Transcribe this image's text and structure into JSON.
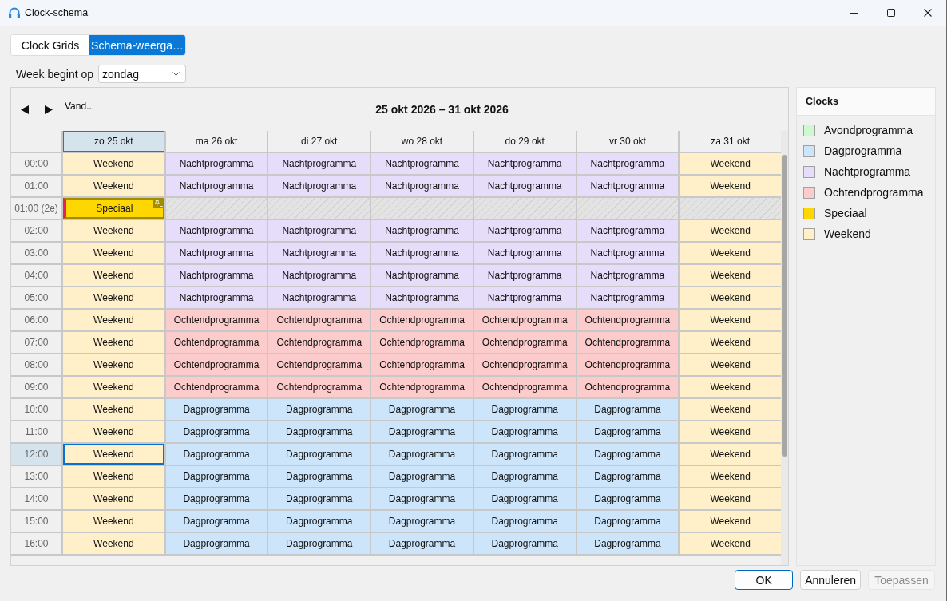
{
  "window": {
    "title": "Clock-schema"
  },
  "tabs": [
    {
      "label": "Clock Grids",
      "selected": false
    },
    {
      "label": "Schema-weerga…",
      "selected": true
    }
  ],
  "week_start": {
    "label": "Week begint op",
    "value": "zondag"
  },
  "calendar": {
    "today_button": "Vand...",
    "range_title": "25 okt 2026 – 31 okt 2026",
    "columns": [
      {
        "label": "zo 25 okt",
        "selected": true
      },
      {
        "label": "ma 26 okt",
        "selected": false
      },
      {
        "label": "di 27 okt",
        "selected": false
      },
      {
        "label": "wo 28 okt",
        "selected": false
      },
      {
        "label": "do 29 okt",
        "selected": false
      },
      {
        "label": "vr 30 okt",
        "selected": false
      },
      {
        "label": "za 31 okt",
        "selected": false
      }
    ],
    "rows": [
      {
        "time": "00:00",
        "selected": false,
        "cells": [
          {
            "kind": "clock",
            "text": "Weekend",
            "color": "#fff0c9"
          },
          {
            "kind": "clock",
            "text": "Nachtprogramma",
            "color": "#e6ddfb"
          },
          {
            "kind": "clock",
            "text": "Nachtprogramma",
            "color": "#e6ddfb"
          },
          {
            "kind": "clock",
            "text": "Nachtprogramma",
            "color": "#e6ddfb"
          },
          {
            "kind": "clock",
            "text": "Nachtprogramma",
            "color": "#e6ddfb"
          },
          {
            "kind": "clock",
            "text": "Nachtprogramma",
            "color": "#e6ddfb"
          },
          {
            "kind": "clock",
            "text": "Weekend",
            "color": "#fff0c9"
          }
        ]
      },
      {
        "time": "01:00",
        "selected": false,
        "cells": [
          {
            "kind": "clock",
            "text": "Weekend",
            "color": "#fff0c9"
          },
          {
            "kind": "clock",
            "text": "Nachtprogramma",
            "color": "#e6ddfb"
          },
          {
            "kind": "clock",
            "text": "Nachtprogramma",
            "color": "#e6ddfb"
          },
          {
            "kind": "clock",
            "text": "Nachtprogramma",
            "color": "#e6ddfb"
          },
          {
            "kind": "clock",
            "text": "Nachtprogramma",
            "color": "#e6ddfb"
          },
          {
            "kind": "clock",
            "text": "Nachtprogramma",
            "color": "#e6ddfb"
          },
          {
            "kind": "clock",
            "text": "Weekend",
            "color": "#fff0c9"
          }
        ]
      },
      {
        "time": "01:00 (2e)",
        "selected": false,
        "cells": [
          {
            "kind": "event",
            "text": "Speciaal",
            "color": "#ffd700"
          },
          {
            "kind": "unavailable"
          },
          {
            "kind": "unavailable"
          },
          {
            "kind": "unavailable"
          },
          {
            "kind": "unavailable"
          },
          {
            "kind": "unavailable"
          },
          {
            "kind": "unavailable"
          }
        ]
      },
      {
        "time": "02:00",
        "selected": false,
        "cells": [
          {
            "kind": "clock",
            "text": "Weekend",
            "color": "#fff0c9"
          },
          {
            "kind": "clock",
            "text": "Nachtprogramma",
            "color": "#e6ddfb"
          },
          {
            "kind": "clock",
            "text": "Nachtprogramma",
            "color": "#e6ddfb"
          },
          {
            "kind": "clock",
            "text": "Nachtprogramma",
            "color": "#e6ddfb"
          },
          {
            "kind": "clock",
            "text": "Nachtprogramma",
            "color": "#e6ddfb"
          },
          {
            "kind": "clock",
            "text": "Nachtprogramma",
            "color": "#e6ddfb"
          },
          {
            "kind": "clock",
            "text": "Weekend",
            "color": "#fff0c9"
          }
        ]
      },
      {
        "time": "03:00",
        "selected": false,
        "cells": [
          {
            "kind": "clock",
            "text": "Weekend",
            "color": "#fff0c9"
          },
          {
            "kind": "clock",
            "text": "Nachtprogramma",
            "color": "#e6ddfb"
          },
          {
            "kind": "clock",
            "text": "Nachtprogramma",
            "color": "#e6ddfb"
          },
          {
            "kind": "clock",
            "text": "Nachtprogramma",
            "color": "#e6ddfb"
          },
          {
            "kind": "clock",
            "text": "Nachtprogramma",
            "color": "#e6ddfb"
          },
          {
            "kind": "clock",
            "text": "Nachtprogramma",
            "color": "#e6ddfb"
          },
          {
            "kind": "clock",
            "text": "Weekend",
            "color": "#fff0c9"
          }
        ]
      },
      {
        "time": "04:00",
        "selected": false,
        "cells": [
          {
            "kind": "clock",
            "text": "Weekend",
            "color": "#fff0c9"
          },
          {
            "kind": "clock",
            "text": "Nachtprogramma",
            "color": "#e6ddfb"
          },
          {
            "kind": "clock",
            "text": "Nachtprogramma",
            "color": "#e6ddfb"
          },
          {
            "kind": "clock",
            "text": "Nachtprogramma",
            "color": "#e6ddfb"
          },
          {
            "kind": "clock",
            "text": "Nachtprogramma",
            "color": "#e6ddfb"
          },
          {
            "kind": "clock",
            "text": "Nachtprogramma",
            "color": "#e6ddfb"
          },
          {
            "kind": "clock",
            "text": "Weekend",
            "color": "#fff0c9"
          }
        ]
      },
      {
        "time": "05:00",
        "selected": false,
        "cells": [
          {
            "kind": "clock",
            "text": "Weekend",
            "color": "#fff0c9"
          },
          {
            "kind": "clock",
            "text": "Nachtprogramma",
            "color": "#e6ddfb"
          },
          {
            "kind": "clock",
            "text": "Nachtprogramma",
            "color": "#e6ddfb"
          },
          {
            "kind": "clock",
            "text": "Nachtprogramma",
            "color": "#e6ddfb"
          },
          {
            "kind": "clock",
            "text": "Nachtprogramma",
            "color": "#e6ddfb"
          },
          {
            "kind": "clock",
            "text": "Nachtprogramma",
            "color": "#e6ddfb"
          },
          {
            "kind": "clock",
            "text": "Weekend",
            "color": "#fff0c9"
          }
        ]
      },
      {
        "time": "06:00",
        "selected": false,
        "cells": [
          {
            "kind": "clock",
            "text": "Weekend",
            "color": "#fff0c9"
          },
          {
            "kind": "clock",
            "text": "Ochtendprogramma",
            "color": "#fccbcb"
          },
          {
            "kind": "clock",
            "text": "Ochtendprogramma",
            "color": "#fccbcb"
          },
          {
            "kind": "clock",
            "text": "Ochtendprogramma",
            "color": "#fccbcb"
          },
          {
            "kind": "clock",
            "text": "Ochtendprogramma",
            "color": "#fccbcb"
          },
          {
            "kind": "clock",
            "text": "Ochtendprogramma",
            "color": "#fccbcb"
          },
          {
            "kind": "clock",
            "text": "Weekend",
            "color": "#fff0c9"
          }
        ]
      },
      {
        "time": "07:00",
        "selected": false,
        "cells": [
          {
            "kind": "clock",
            "text": "Weekend",
            "color": "#fff0c9"
          },
          {
            "kind": "clock",
            "text": "Ochtendprogramma",
            "color": "#fccbcb"
          },
          {
            "kind": "clock",
            "text": "Ochtendprogramma",
            "color": "#fccbcb"
          },
          {
            "kind": "clock",
            "text": "Ochtendprogramma",
            "color": "#fccbcb"
          },
          {
            "kind": "clock",
            "text": "Ochtendprogramma",
            "color": "#fccbcb"
          },
          {
            "kind": "clock",
            "text": "Ochtendprogramma",
            "color": "#fccbcb"
          },
          {
            "kind": "clock",
            "text": "Weekend",
            "color": "#fff0c9"
          }
        ]
      },
      {
        "time": "08:00",
        "selected": false,
        "cells": [
          {
            "kind": "clock",
            "text": "Weekend",
            "color": "#fff0c9"
          },
          {
            "kind": "clock",
            "text": "Ochtendprogramma",
            "color": "#fccbcb"
          },
          {
            "kind": "clock",
            "text": "Ochtendprogramma",
            "color": "#fccbcb"
          },
          {
            "kind": "clock",
            "text": "Ochtendprogramma",
            "color": "#fccbcb"
          },
          {
            "kind": "clock",
            "text": "Ochtendprogramma",
            "color": "#fccbcb"
          },
          {
            "kind": "clock",
            "text": "Ochtendprogramma",
            "color": "#fccbcb"
          },
          {
            "kind": "clock",
            "text": "Weekend",
            "color": "#fff0c9"
          }
        ]
      },
      {
        "time": "09:00",
        "selected": false,
        "cells": [
          {
            "kind": "clock",
            "text": "Weekend",
            "color": "#fff0c9"
          },
          {
            "kind": "clock",
            "text": "Ochtendprogramma",
            "color": "#fccbcb"
          },
          {
            "kind": "clock",
            "text": "Ochtendprogramma",
            "color": "#fccbcb"
          },
          {
            "kind": "clock",
            "text": "Ochtendprogramma",
            "color": "#fccbcb"
          },
          {
            "kind": "clock",
            "text": "Ochtendprogramma",
            "color": "#fccbcb"
          },
          {
            "kind": "clock",
            "text": "Ochtendprogramma",
            "color": "#fccbcb"
          },
          {
            "kind": "clock",
            "text": "Weekend",
            "color": "#fff0c9"
          }
        ]
      },
      {
        "time": "10:00",
        "selected": false,
        "cells": [
          {
            "kind": "clock",
            "text": "Weekend",
            "color": "#fff0c9"
          },
          {
            "kind": "clock",
            "text": "Dagprogramma",
            "color": "#cce5fb"
          },
          {
            "kind": "clock",
            "text": "Dagprogramma",
            "color": "#cce5fb"
          },
          {
            "kind": "clock",
            "text": "Dagprogramma",
            "color": "#cce5fb"
          },
          {
            "kind": "clock",
            "text": "Dagprogramma",
            "color": "#cce5fb"
          },
          {
            "kind": "clock",
            "text": "Dagprogramma",
            "color": "#cce5fb"
          },
          {
            "kind": "clock",
            "text": "Weekend",
            "color": "#fff0c9"
          }
        ]
      },
      {
        "time": "11:00",
        "selected": false,
        "cells": [
          {
            "kind": "clock",
            "text": "Weekend",
            "color": "#fff0c9"
          },
          {
            "kind": "clock",
            "text": "Dagprogramma",
            "color": "#cce5fb"
          },
          {
            "kind": "clock",
            "text": "Dagprogramma",
            "color": "#cce5fb"
          },
          {
            "kind": "clock",
            "text": "Dagprogramma",
            "color": "#cce5fb"
          },
          {
            "kind": "clock",
            "text": "Dagprogramma",
            "color": "#cce5fb"
          },
          {
            "kind": "clock",
            "text": "Dagprogramma",
            "color": "#cce5fb"
          },
          {
            "kind": "clock",
            "text": "Weekend",
            "color": "#fff0c9"
          }
        ]
      },
      {
        "time": "12:00",
        "selected": true,
        "cells": [
          {
            "kind": "clock",
            "text": "Weekend",
            "color": "#fff0c9"
          },
          {
            "kind": "clock",
            "text": "Dagprogramma",
            "color": "#cce5fb"
          },
          {
            "kind": "clock",
            "text": "Dagprogramma",
            "color": "#cce5fb"
          },
          {
            "kind": "clock",
            "text": "Dagprogramma",
            "color": "#cce5fb"
          },
          {
            "kind": "clock",
            "text": "Dagprogramma",
            "color": "#cce5fb"
          },
          {
            "kind": "clock",
            "text": "Dagprogramma",
            "color": "#cce5fb"
          },
          {
            "kind": "clock",
            "text": "Weekend",
            "color": "#fff0c9"
          }
        ]
      },
      {
        "time": "13:00",
        "selected": false,
        "cells": [
          {
            "kind": "clock",
            "text": "Weekend",
            "color": "#fff0c9"
          },
          {
            "kind": "clock",
            "text": "Dagprogramma",
            "color": "#cce5fb"
          },
          {
            "kind": "clock",
            "text": "Dagprogramma",
            "color": "#cce5fb"
          },
          {
            "kind": "clock",
            "text": "Dagprogramma",
            "color": "#cce5fb"
          },
          {
            "kind": "clock",
            "text": "Dagprogramma",
            "color": "#cce5fb"
          },
          {
            "kind": "clock",
            "text": "Dagprogramma",
            "color": "#cce5fb"
          },
          {
            "kind": "clock",
            "text": "Weekend",
            "color": "#fff0c9"
          }
        ]
      },
      {
        "time": "14:00",
        "selected": false,
        "cells": [
          {
            "kind": "clock",
            "text": "Weekend",
            "color": "#fff0c9"
          },
          {
            "kind": "clock",
            "text": "Dagprogramma",
            "color": "#cce5fb"
          },
          {
            "kind": "clock",
            "text": "Dagprogramma",
            "color": "#cce5fb"
          },
          {
            "kind": "clock",
            "text": "Dagprogramma",
            "color": "#cce5fb"
          },
          {
            "kind": "clock",
            "text": "Dagprogramma",
            "color": "#cce5fb"
          },
          {
            "kind": "clock",
            "text": "Dagprogramma",
            "color": "#cce5fb"
          },
          {
            "kind": "clock",
            "text": "Weekend",
            "color": "#fff0c9"
          }
        ]
      },
      {
        "time": "15:00",
        "selected": false,
        "cells": [
          {
            "kind": "clock",
            "text": "Weekend",
            "color": "#fff0c9"
          },
          {
            "kind": "clock",
            "text": "Dagprogramma",
            "color": "#cce5fb"
          },
          {
            "kind": "clock",
            "text": "Dagprogramma",
            "color": "#cce5fb"
          },
          {
            "kind": "clock",
            "text": "Dagprogramma",
            "color": "#cce5fb"
          },
          {
            "kind": "clock",
            "text": "Dagprogramma",
            "color": "#cce5fb"
          },
          {
            "kind": "clock",
            "text": "Dagprogramma",
            "color": "#cce5fb"
          },
          {
            "kind": "clock",
            "text": "Weekend",
            "color": "#fff0c9"
          }
        ]
      },
      {
        "time": "16:00",
        "selected": false,
        "cells": [
          {
            "kind": "clock",
            "text": "Weekend",
            "color": "#fff0c9"
          },
          {
            "kind": "clock",
            "text": "Dagprogramma",
            "color": "#cce5fb"
          },
          {
            "kind": "clock",
            "text": "Dagprogramma",
            "color": "#cce5fb"
          },
          {
            "kind": "clock",
            "text": "Dagprogramma",
            "color": "#cce5fb"
          },
          {
            "kind": "clock",
            "text": "Dagprogramma",
            "color": "#cce5fb"
          },
          {
            "kind": "clock",
            "text": "Dagprogramma",
            "color": "#cce5fb"
          },
          {
            "kind": "clock",
            "text": "Weekend",
            "color": "#fff0c9"
          }
        ]
      }
    ]
  },
  "legend": {
    "title": "Clocks",
    "items": [
      {
        "name": "Avondprogramma",
        "color": "#ccf9cf"
      },
      {
        "name": "Dagprogramma",
        "color": "#cce5fb"
      },
      {
        "name": "Nachtprogramma",
        "color": "#e6ddfb"
      },
      {
        "name": "Ochtendprogramma",
        "color": "#fccbcb"
      },
      {
        "name": "Speciaal",
        "color": "#ffd700"
      },
      {
        "name": "Weekend",
        "color": "#fff0c9"
      }
    ]
  },
  "buttons": [
    {
      "label": "OK",
      "default": true,
      "disabled": false
    },
    {
      "label": "Annuleren",
      "default": false,
      "disabled": false
    },
    {
      "label": "Toepassen",
      "default": false,
      "disabled": true
    }
  ]
}
